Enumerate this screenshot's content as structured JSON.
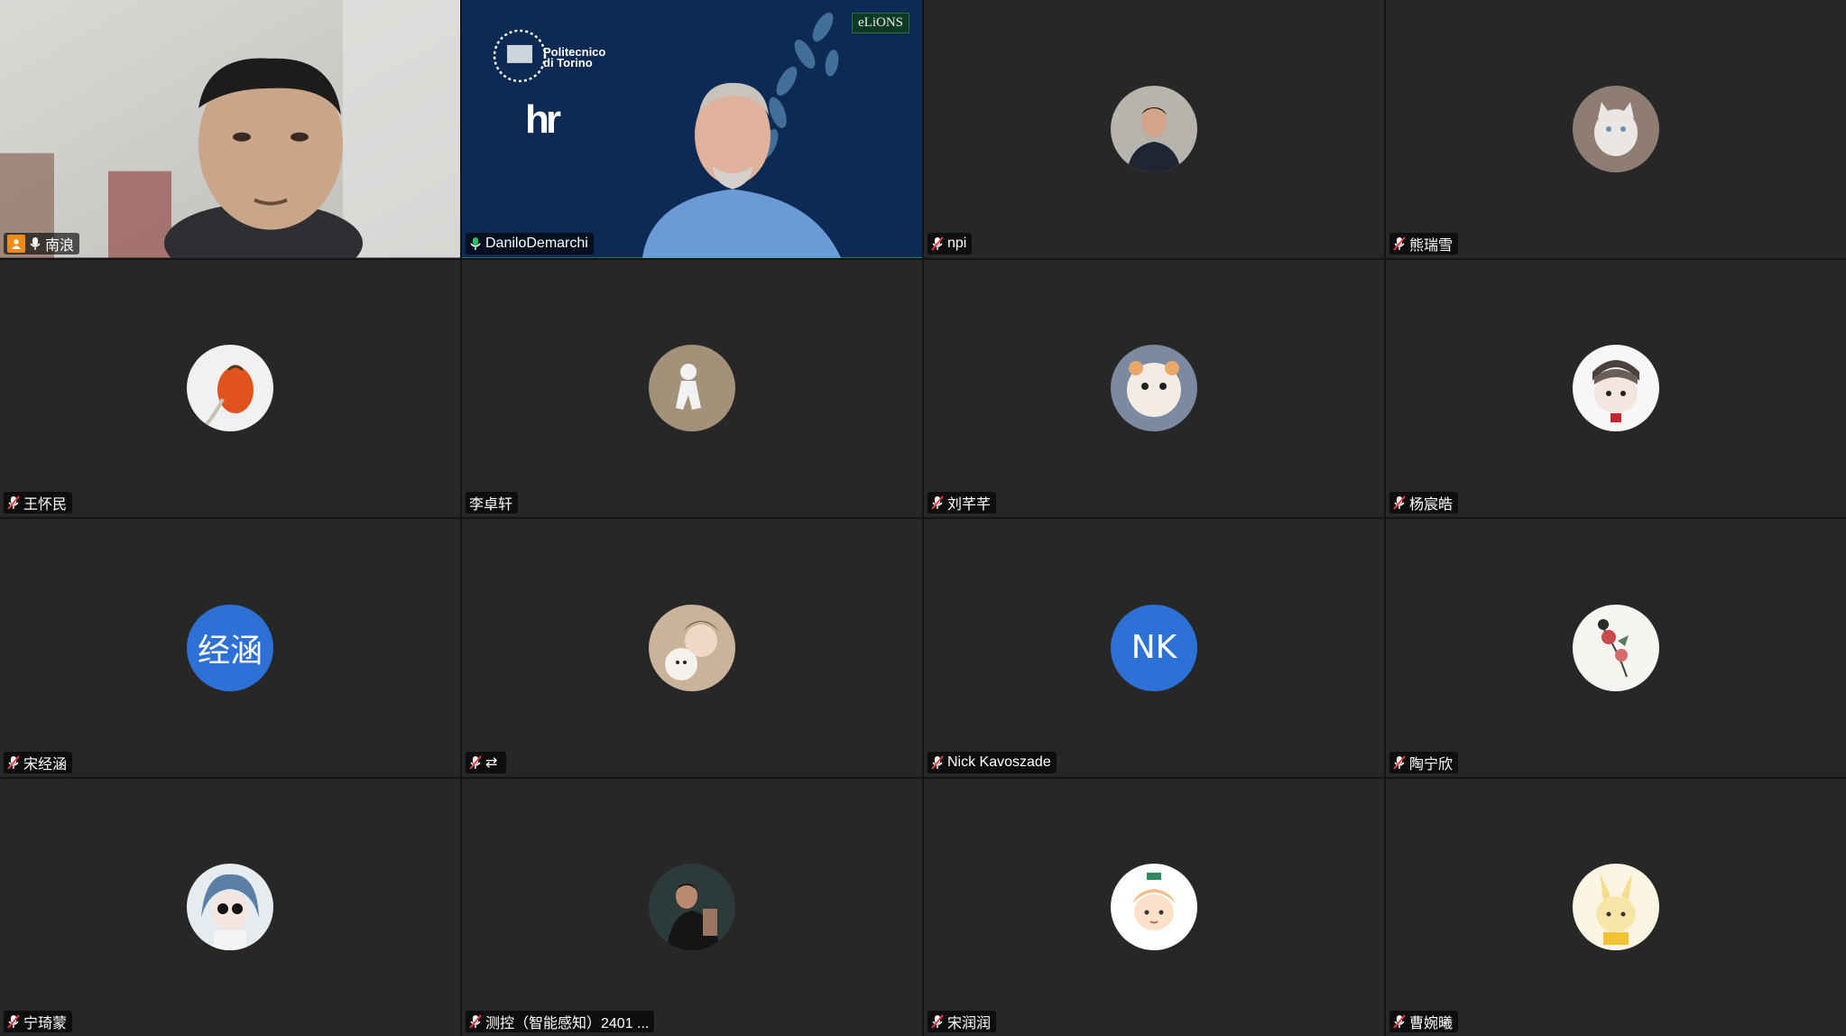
{
  "meeting": {
    "participants": [
      {
        "name": "南浪",
        "mic": "on",
        "video": true,
        "host_badge": true
      },
      {
        "name": "DaniloDemarchi",
        "mic": "on",
        "video": true,
        "active_speaker": true,
        "slide": {
          "institution": "Politecnico di Torino",
          "logo_right": "eLiONS",
          "logo_hr": "hr"
        }
      },
      {
        "name": "npi",
        "mic": "muted",
        "avatar": "photo-man"
      },
      {
        "name": "熊瑞雪",
        "mic": "muted",
        "avatar": "photo-cat"
      },
      {
        "name": "王怀民",
        "mic": "muted",
        "avatar": "photo-orange-lantern"
      },
      {
        "name": "李卓轩",
        "mic": "none",
        "avatar": "figure-toy"
      },
      {
        "name": "刘芊芊",
        "mic": "muted",
        "avatar": "plush-toy"
      },
      {
        "name": "杨宸皓",
        "mic": "muted",
        "avatar": "anime-character"
      },
      {
        "name": "宋经涵",
        "mic": "muted",
        "avatar_initials": "经涵"
      },
      {
        "name": "",
        "mic": "muted",
        "swap_icon": true,
        "avatar": "anime-girl-lamb"
      },
      {
        "name": "Nick Kavoszade",
        "mic": "muted",
        "avatar_initials": "NK"
      },
      {
        "name": "陶宁欣",
        "mic": "muted",
        "avatar": "flower-painting"
      },
      {
        "name": "宁琦蒙",
        "mic": "muted",
        "avatar": "anime-girl-glasses"
      },
      {
        "name": "测控（智能感知）2401 ...",
        "mic": "muted",
        "avatar": "photo-man-dark"
      },
      {
        "name": "宋润润",
        "mic": "muted",
        "avatar": "cartoon-boy"
      },
      {
        "name": "曹婉曦",
        "mic": "muted",
        "avatar": "yellow-bunny"
      }
    ]
  },
  "colors": {
    "tile_bg": "#272727",
    "active_border": "#23c26b",
    "initials_bg": "#2e71d6",
    "host_badge": "#f08c16"
  }
}
